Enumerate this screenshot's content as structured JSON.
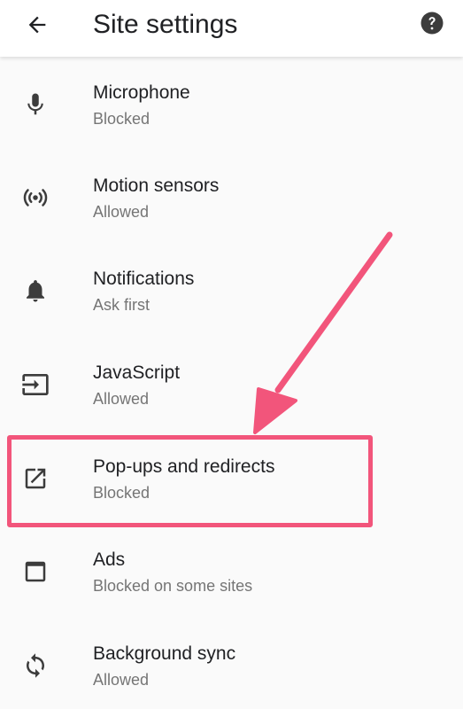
{
  "toolbar": {
    "title": "Site settings",
    "back_icon": "arrow-back-icon",
    "help_icon": "help-icon"
  },
  "items": [
    {
      "label": "Microphone",
      "status": "Blocked",
      "icon": "microphone-icon"
    },
    {
      "label": "Motion sensors",
      "status": "Allowed",
      "icon": "motion-sensors-icon"
    },
    {
      "label": "Notifications",
      "status": "Ask first",
      "icon": "bell-icon"
    },
    {
      "label": "JavaScript",
      "status": "Allowed",
      "icon": "javascript-icon"
    },
    {
      "label": "Pop-ups and redirects",
      "status": "Blocked",
      "icon": "open-in-new-icon"
    },
    {
      "label": "Ads",
      "status": "Blocked on some sites",
      "icon": "ads-window-icon"
    },
    {
      "label": "Background sync",
      "status": "Allowed",
      "icon": "sync-icon"
    }
  ],
  "colors": {
    "highlight": "#f2557b",
    "text_primary": "#202124",
    "text_secondary": "#757575",
    "icon": "#3c3c3c"
  }
}
